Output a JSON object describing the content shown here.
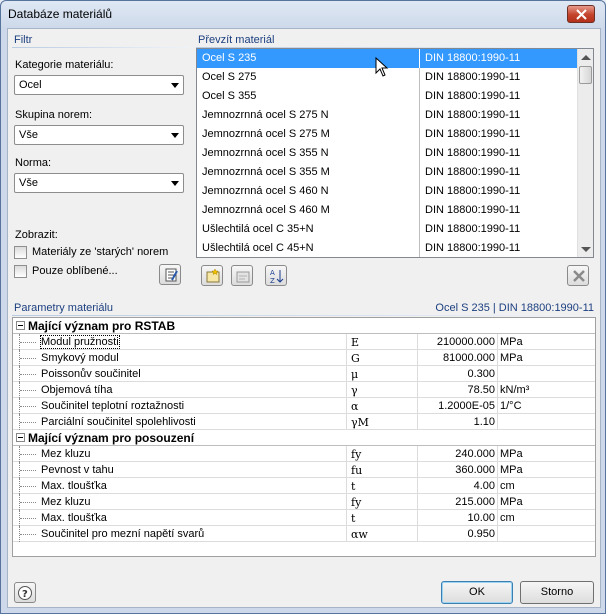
{
  "window": {
    "title": "Databáze materiálů"
  },
  "filter": {
    "header": "Filtr",
    "category_label": "Kategorie materiálu:",
    "category_value": "Ocel",
    "group_label": "Skupina norem:",
    "group_value": "Vše",
    "norm_label": "Norma:",
    "norm_value": "Vše",
    "show_label": "Zobrazit:",
    "old_norms_label": "Materiály ze 'starých' norem",
    "favorites_label": "Pouze oblíbené..."
  },
  "take_material": {
    "header": "Převzít materiál",
    "items": [
      {
        "name": "Ocel S 235",
        "norm": "DIN 18800:1990-11",
        "selected": true
      },
      {
        "name": "Ocel S 275",
        "norm": "DIN 18800:1990-11"
      },
      {
        "name": "Ocel S 355",
        "norm": "DIN 18800:1990-11"
      },
      {
        "name": "Jemnozrnná ocel S 275 N",
        "norm": "DIN 18800:1990-11"
      },
      {
        "name": "Jemnozrnná ocel S 275 M",
        "norm": "DIN 18800:1990-11"
      },
      {
        "name": "Jemnozrnná ocel S 355 N",
        "norm": "DIN 18800:1990-11"
      },
      {
        "name": "Jemnozrnná ocel S 355 M",
        "norm": "DIN 18800:1990-11"
      },
      {
        "name": "Jemnozrnná ocel S 460 N",
        "norm": "DIN 18800:1990-11"
      },
      {
        "name": "Jemnozrnná ocel S 460 M",
        "norm": "DIN 18800:1990-11"
      },
      {
        "name": "Ušlechtilá ocel C 35+N",
        "norm": "DIN 18800:1990-11"
      },
      {
        "name": "Ušlechtilá ocel C 45+N",
        "norm": "DIN 18800:1990-11"
      }
    ]
  },
  "params": {
    "header": "Parametry materiálu",
    "header_right": "Ocel S 235 | DIN 18800:1990-11",
    "groups": [
      {
        "title": "Mající význam pro RSTAB",
        "rows": [
          {
            "name": "Modul pružnosti",
            "symbol": "E",
            "value": "210000.000",
            "unit": "MPa"
          },
          {
            "name": "Smykový modul",
            "symbol": "G",
            "value": "81000.000",
            "unit": "MPa"
          },
          {
            "name": "Poissonův součinitel",
            "symbol": "μ",
            "value": "0.300",
            "unit": ""
          },
          {
            "name": "Objemová tíha",
            "symbol": "γ",
            "value": "78.50",
            "unit": "kN/m³"
          },
          {
            "name": "Součinitel teplotní roztažnosti",
            "symbol": "α",
            "value": "1.2000E-05",
            "unit": "1/°C"
          },
          {
            "name": "Parciální součinitel spolehlivosti",
            "symbol": "γM",
            "value": "1.10",
            "unit": ""
          }
        ]
      },
      {
        "title": "Mající význam pro posouzení",
        "rows": [
          {
            "name": "Mez kluzu",
            "symbol": "fy",
            "value": "240.000",
            "unit": "MPa"
          },
          {
            "name": "Pevnost v tahu",
            "symbol": "fu",
            "value": "360.000",
            "unit": "MPa"
          },
          {
            "name": "Max. tloušťka",
            "symbol": "t",
            "value": "4.00",
            "unit": "cm"
          },
          {
            "name": "Mez kluzu",
            "symbol": "fy",
            "value": "215.000",
            "unit": "MPa"
          },
          {
            "name": "Max. tloušťka",
            "symbol": "t",
            "value": "10.00",
            "unit": "cm"
          },
          {
            "name": "Součinitel pro mezní napětí svarů",
            "symbol": "αw",
            "value": "0.950",
            "unit": ""
          }
        ]
      }
    ]
  },
  "buttons": {
    "ok": "OK",
    "cancel": "Storno"
  }
}
